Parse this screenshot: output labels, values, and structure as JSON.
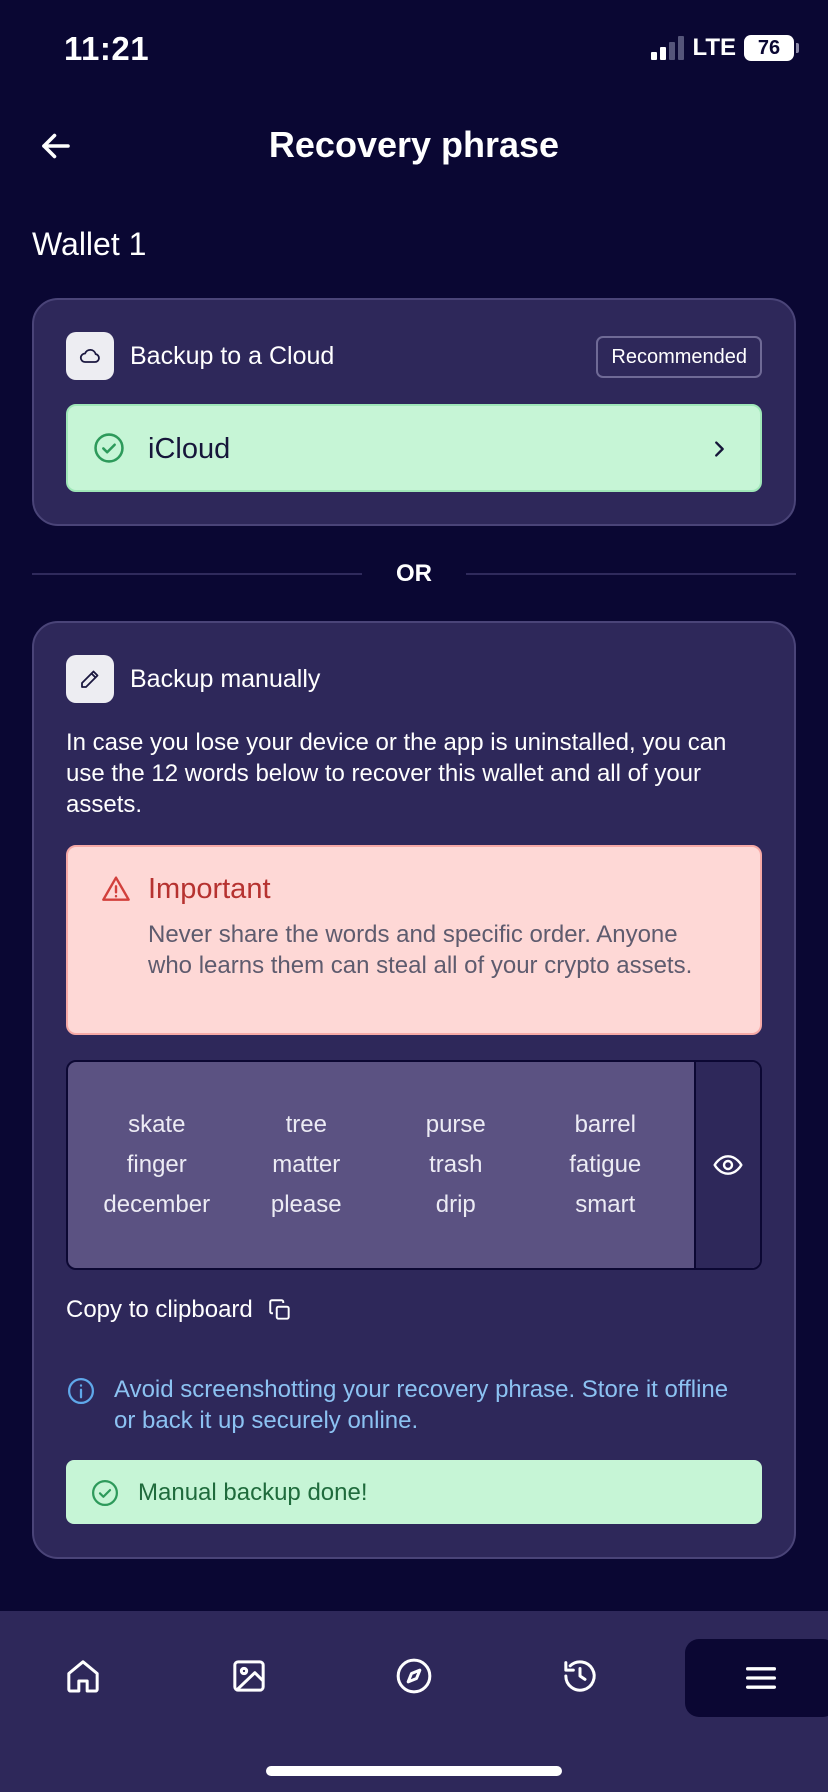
{
  "status_bar": {
    "time": "11:21",
    "network": "LTE",
    "battery": "76"
  },
  "header": {
    "title": "Recovery phrase"
  },
  "wallet": {
    "name": "Wallet 1"
  },
  "cloud_backup": {
    "title": "Backup to a Cloud",
    "badge": "Recommended",
    "provider": "iCloud"
  },
  "divider": {
    "text": "OR"
  },
  "manual_backup": {
    "title": "Backup manually",
    "description": "In case you lose your device or the app is uninstalled, you can use the 12 words below to recover this wallet and all of your assets.",
    "important_title": "Important",
    "important_text": "Never share the words and specific order. Anyone who learns them can steal all of your crypto assets.",
    "words": [
      "skate",
      "tree",
      "purse",
      "barrel",
      "finger",
      "matter",
      "trash",
      "fatigue",
      "december",
      "please",
      "drip",
      "smart"
    ],
    "copy_label": "Copy to clipboard",
    "info_text": "Avoid screenshotting your recovery phrase. Store it offline or back it up securely online.",
    "done_label": "Manual backup done!"
  },
  "tabbar": {
    "items": [
      "home-icon",
      "image-icon",
      "compass-icon",
      "history-icon",
      "menu-icon"
    ],
    "active": "menu-icon"
  },
  "colors": {
    "background": "#0a0733",
    "card": "#2e285a",
    "success": "#c6f5d6",
    "warning_bg": "#fed8d6",
    "info": "#8cc2f2"
  }
}
